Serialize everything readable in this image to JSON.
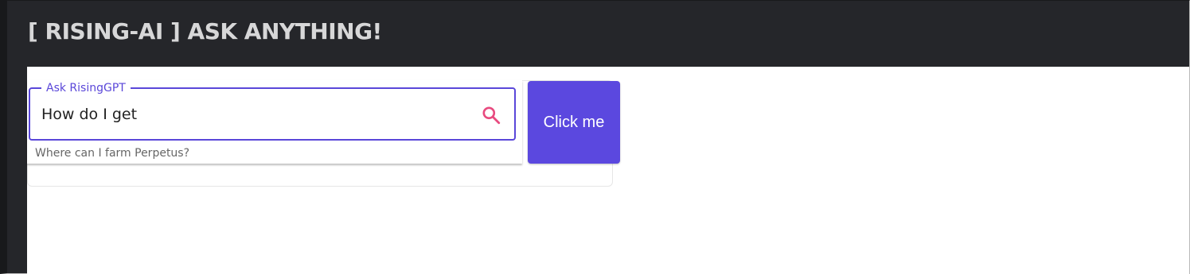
{
  "header": {
    "title": "[ RISING-AI ] ASK ANYTHING!"
  },
  "search": {
    "label": "Ask RisingGPT",
    "value": "How do I get",
    "icon": "search-icon",
    "suggestions": [
      "Where can I farm Perpetus?"
    ]
  },
  "action": {
    "button_label": "Click me"
  },
  "colors": {
    "accent": "#5b48df",
    "search_icon": "#e84a7f",
    "header_bg": "#25262a"
  }
}
